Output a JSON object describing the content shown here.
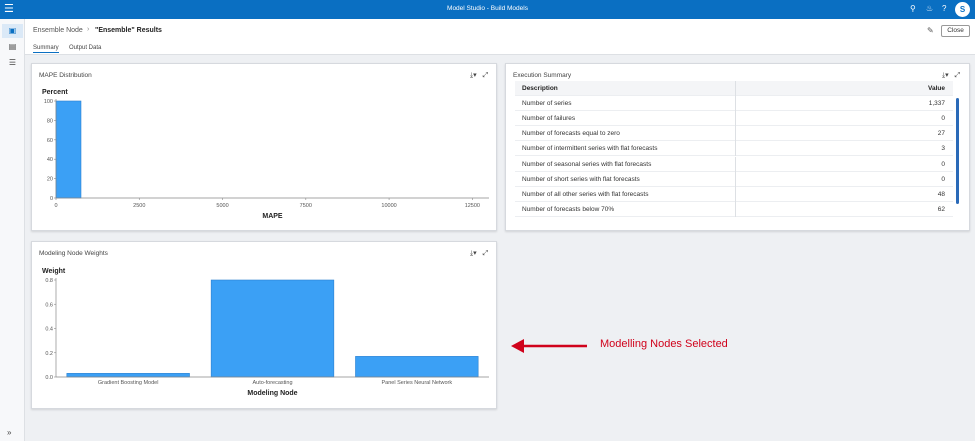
{
  "app": {
    "title": "Model Studio - Build Models",
    "avatar": "S"
  },
  "icons": {
    "menu": "hamburger-menu-icon",
    "search": "search-icon",
    "notifications": "bell-icon",
    "help": "help-icon",
    "download": "download-icon",
    "expand": "expand-icon"
  },
  "header": {
    "breadcrumb": "Ensemble Node",
    "current": "\"Ensemble\" Results",
    "close_label": "Close",
    "tabs": [
      {
        "label": "Summary",
        "active": true
      },
      {
        "label": "Output Data",
        "active": false
      }
    ]
  },
  "panels": {
    "mape": {
      "title": "MAPE Distribution"
    },
    "weights": {
      "title": "Modeling Node Weights"
    },
    "exec": {
      "title": "Execution Summary",
      "columns": {
        "description": "Description",
        "value": "Value"
      },
      "rows": [
        {
          "description": "Number of series",
          "value": "1,337"
        },
        {
          "description": "Number of failures",
          "value": "0"
        },
        {
          "description": "Number of forecasts equal to zero",
          "value": "27"
        },
        {
          "description": "Number of intermittent series with flat forecasts",
          "value": "3"
        },
        {
          "description": "Number of seasonal series with flat forecasts",
          "value": "0"
        },
        {
          "description": "Number of short series with flat forecasts",
          "value": "0"
        },
        {
          "description": "Number of all other series with flat forecasts",
          "value": "48"
        },
        {
          "description": "Number of forecasts below 70%",
          "value": "62"
        }
      ]
    }
  },
  "annotation": {
    "text": "Modelling Nodes Selected",
    "color": "#d0021b"
  },
  "colors": {
    "accent": "#0a6fc2",
    "bar": "#3ba0f5",
    "bar_stroke": "#2a7fd0"
  },
  "chart_data": [
    {
      "type": "bar",
      "title": "",
      "xlabel": "MAPE",
      "ylabel": "Percent",
      "x_ticks": [
        0,
        2500,
        5000,
        7500,
        10000,
        12500
      ],
      "xlim": [
        0,
        13000
      ],
      "ylim": [
        0,
        100
      ],
      "y_ticks": [
        0,
        20,
        40,
        60,
        80,
        100
      ],
      "bins": [
        {
          "start": 0,
          "end": 750,
          "value": 100
        }
      ],
      "grid": false
    },
    {
      "type": "bar",
      "title": "",
      "xlabel": "Modeling Node",
      "ylabel": "Weight",
      "categories": [
        "Gradient Boosting Model",
        "Auto-forecasting",
        "Panel Series Neural Network"
      ],
      "values": [
        0.03,
        0.8,
        0.17
      ],
      "ylim": [
        0,
        0.8
      ],
      "y_ticks": [
        0.0,
        0.2,
        0.4,
        0.6,
        0.8
      ],
      "grid": false
    }
  ]
}
